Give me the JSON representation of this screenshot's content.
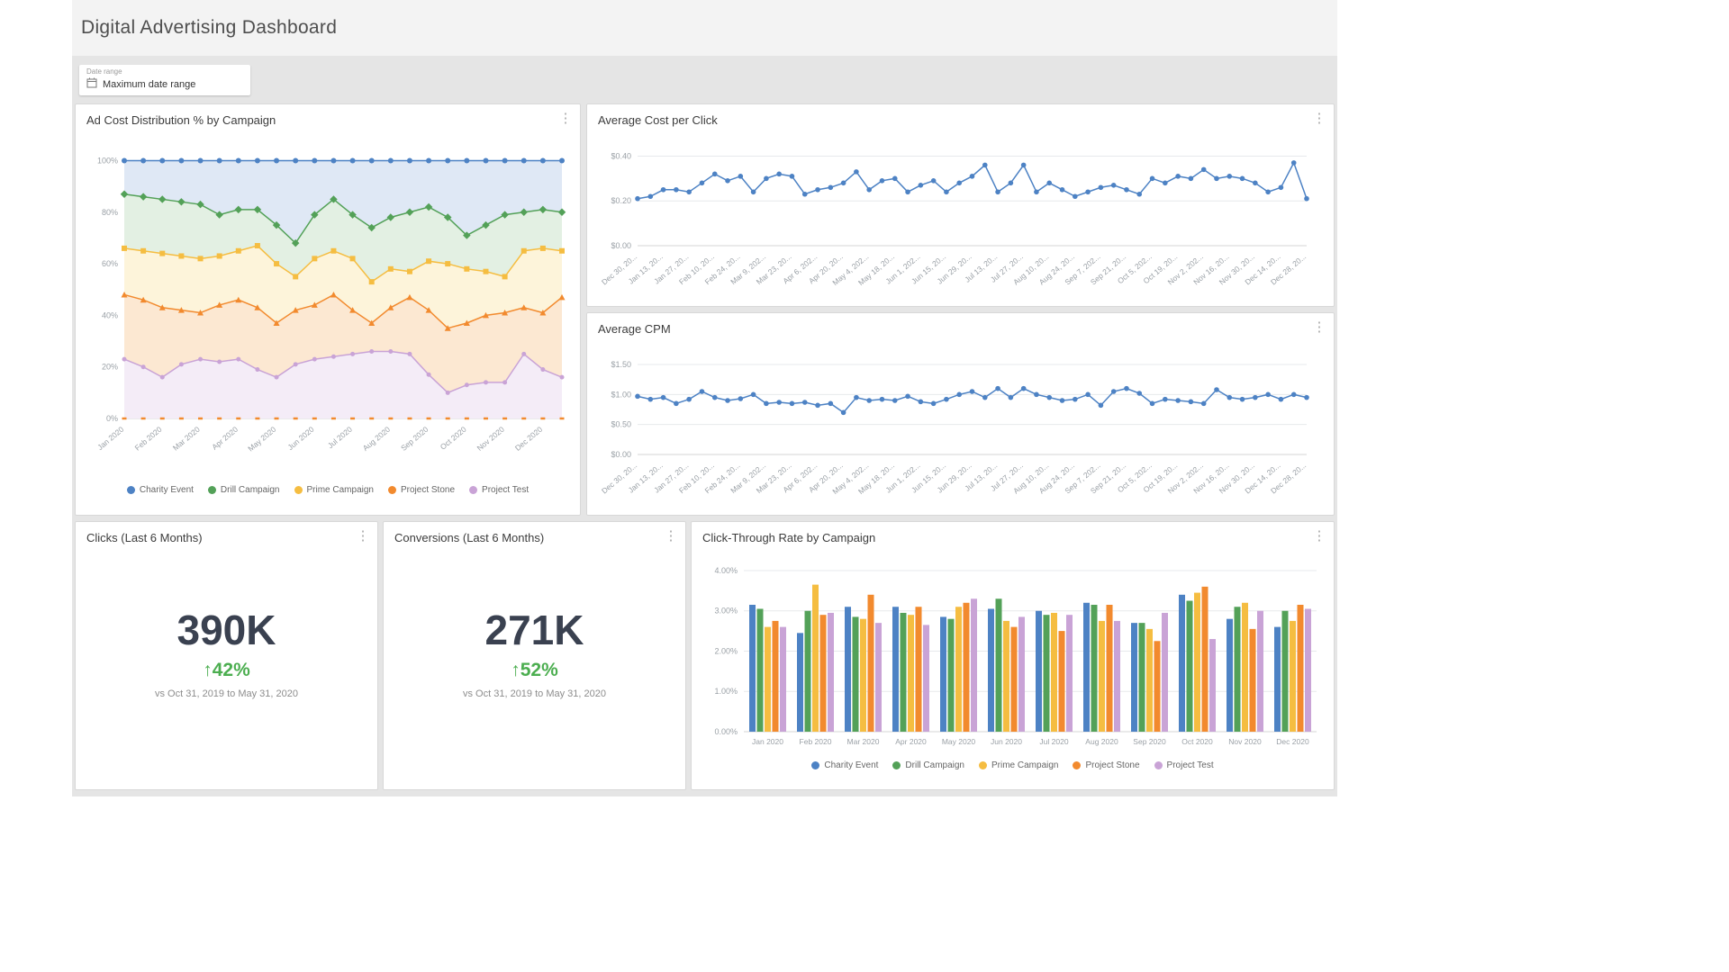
{
  "page": {
    "title": "Digital Advertising Dashboard"
  },
  "filter": {
    "label": "Date range",
    "value": "Maximum date range"
  },
  "cards": {
    "clicks": {
      "title": "Clicks (Last 6 Months)",
      "value": "390K",
      "delta": "↑42%",
      "compare": "vs Oct 31, 2019 to May 31, 2020"
    },
    "conversions": {
      "title": "Conversions (Last 6 Months)",
      "value": "271K",
      "delta": "↑52%",
      "compare": "vs Oct 31, 2019 to May 31, 2020"
    }
  },
  "chart_data": [
    {
      "type": "area",
      "title": "Ad Cost Distribution % by Campaign",
      "stacked_fill": true,
      "rotate_labels": true,
      "tick_labels": [
        "Jan 2020",
        "Feb 2020",
        "Mar 2020",
        "Apr 2020",
        "May 2020",
        "Jun 2020",
        "Jul 2020",
        "Aug 2020",
        "Sep 2020",
        "Oct 2020",
        "Nov 2020",
        "Dec 2020"
      ],
      "tick_every": 2,
      "ylim": [
        0,
        104
      ],
      "y_ticks": [
        0,
        20,
        40,
        60,
        80,
        100
      ],
      "y_tick_labels": [
        "0%",
        "20%",
        "40%",
        "60%",
        "80%",
        "100%"
      ],
      "series": [
        {
          "name": "Charity Event",
          "color": "#4d82c4",
          "fill": "#dfe8f5",
          "marker": "circle",
          "marker_r": 3,
          "values": [
            100,
            100,
            100,
            100,
            100,
            100,
            100,
            100,
            100,
            100,
            100,
            100,
            100,
            100,
            100,
            100,
            100,
            100,
            100,
            100,
            100,
            100,
            100,
            100
          ]
        },
        {
          "name": "Drill Campaign",
          "color": "#53a158",
          "fill": "#e3f0e3",
          "marker": "diamond",
          "marker_r": 3,
          "values": [
            87,
            86,
            85,
            84,
            83,
            79,
            81,
            81,
            75,
            68,
            79,
            85,
            79,
            74,
            78,
            80,
            82,
            78,
            71,
            75,
            79,
            80,
            81,
            80
          ]
        },
        {
          "name": "Prime Campaign",
          "color": "#f5bd41",
          "fill": "#fdf4da",
          "marker": "square",
          "marker_r": 3,
          "values": [
            66,
            65,
            64,
            63,
            62,
            63,
            65,
            67,
            60,
            55,
            62,
            65,
            62,
            53,
            58,
            57,
            61,
            60,
            58,
            57,
            55,
            65,
            66,
            65
          ]
        },
        {
          "name": "Project Stone",
          "color": "#f28a2e",
          "fill": "#fce8d2",
          "marker": "triangle",
          "marker_r": 3,
          "values": [
            48,
            46,
            43,
            42,
            41,
            44,
            46,
            43,
            37,
            42,
            44,
            48,
            42,
            37,
            43,
            47,
            42,
            35,
            37,
            40,
            41,
            43,
            41,
            47
          ]
        },
        {
          "name": "Project Test",
          "color": "#c9a3d6",
          "fill": "#f4ecf7",
          "marker": "circle",
          "marker_r": 2.5,
          "values": [
            23,
            20,
            16,
            21,
            23,
            22,
            23,
            19,
            16,
            21,
            23,
            24,
            25,
            26,
            26,
            25,
            17,
            10,
            13,
            14,
            14,
            25,
            19,
            16
          ]
        },
        {
          "name": "",
          "color": "#f28a2e",
          "marker": "dash",
          "line": false,
          "values": [
            0,
            0,
            0,
            0,
            0,
            0,
            0,
            0,
            0,
            0,
            0,
            0,
            0,
            0,
            0,
            0,
            0,
            0,
            0,
            0,
            0,
            0,
            0,
            0
          ]
        }
      ],
      "legend": [
        {
          "label": "Charity Event",
          "color": "#4d82c4"
        },
        {
          "label": "Drill Campaign",
          "color": "#53a158"
        },
        {
          "label": "Prime Campaign",
          "color": "#f5bd41"
        },
        {
          "label": "Project Stone",
          "color": "#f28a2e"
        },
        {
          "label": "Project Test",
          "color": "#c9a3d6"
        }
      ]
    },
    {
      "type": "line",
      "title": "Average Cost per Click",
      "rotate_labels": true,
      "tick_labels": [
        "Dec 30, 20...",
        "Jan 13, 20...",
        "Jan 27, 20...",
        "Feb 10, 20...",
        "Feb 24, 20...",
        "Mar 9, 202...",
        "Mar 23, 20...",
        "Apr 6, 202...",
        "Apr 20, 20...",
        "May 4, 202...",
        "May 18, 20...",
        "Jun 1, 202...",
        "Jun 15, 20...",
        "Jun 29, 20...",
        "Jul 13, 20...",
        "Jul 27, 20...",
        "Aug 10, 20...",
        "Aug 24, 20...",
        "Sep 7, 202...",
        "Sep 21, 20...",
        "Oct 5, 202...",
        "Oct 19, 20...",
        "Nov 2, 202...",
        "Nov 16, 20...",
        "Nov 30, 20...",
        "Dec 14, 20...",
        "Dec 28, 20..."
      ],
      "tick_every": 2,
      "ylim": [
        0,
        0.45
      ],
      "y_ticks": [
        0,
        0.2,
        0.4
      ],
      "y_tick_labels": [
        "$0.00",
        "$0.20",
        "$0.40"
      ],
      "series": [
        {
          "name": "Average Cost per Click",
          "color": "#4d82c4",
          "marker": "circle",
          "marker_r": 2.8,
          "values": [
            0.21,
            0.22,
            0.25,
            0.25,
            0.24,
            0.28,
            0.32,
            0.29,
            0.31,
            0.24,
            0.3,
            0.32,
            0.31,
            0.23,
            0.25,
            0.26,
            0.28,
            0.33,
            0.25,
            0.29,
            0.3,
            0.24,
            0.27,
            0.29,
            0.24,
            0.28,
            0.31,
            0.36,
            0.24,
            0.28,
            0.36,
            0.24,
            0.28,
            0.25,
            0.22,
            0.24,
            0.26,
            0.27,
            0.25,
            0.23,
            0.3,
            0.28,
            0.31,
            0.3,
            0.34,
            0.3,
            0.31,
            0.3,
            0.28,
            0.24,
            0.26,
            0.37,
            0.21
          ]
        }
      ]
    },
    {
      "type": "line",
      "title": "Average CPM",
      "rotate_labels": true,
      "tick_labels": [
        "Dec 30, 20...",
        "Jan 13, 20...",
        "Jan 27, 20...",
        "Feb 10, 20...",
        "Feb 24, 20...",
        "Mar 9, 202...",
        "Mar 23, 20...",
        "Apr 6, 202...",
        "Apr 20, 20...",
        "May 4, 202...",
        "May 18, 20...",
        "Jun 1, 202...",
        "Jun 15, 20...",
        "Jun 29, 20...",
        "Jul 13, 20...",
        "Jul 27, 20...",
        "Aug 10, 20...",
        "Aug 24, 20...",
        "Sep 7, 202...",
        "Sep 21, 20...",
        "Oct 5, 202...",
        "Oct 19, 20...",
        "Nov 2, 202...",
        "Nov 16, 20...",
        "Nov 30, 20...",
        "Dec 14, 20...",
        "Dec 28, 20..."
      ],
      "tick_every": 2,
      "ylim": [
        0,
        1.68
      ],
      "y_ticks": [
        0,
        0.5,
        1.0,
        1.5
      ],
      "y_tick_labels": [
        "$0.00",
        "$0.50",
        "$1.00",
        "$1.50"
      ],
      "series": [
        {
          "name": "Average CPM",
          "color": "#4d82c4",
          "marker": "circle",
          "marker_r": 2.8,
          "values": [
            0.97,
            0.92,
            0.95,
            0.85,
            0.92,
            1.05,
            0.95,
            0.9,
            0.93,
            1.0,
            0.85,
            0.87,
            0.85,
            0.87,
            0.82,
            0.85,
            0.7,
            0.95,
            0.9,
            0.92,
            0.9,
            0.97,
            0.88,
            0.85,
            0.92,
            1.0,
            1.05,
            0.95,
            1.1,
            0.95,
            1.1,
            1.0,
            0.95,
            0.9,
            0.92,
            1.0,
            0.82,
            1.05,
            1.1,
            1.02,
            0.85,
            0.92,
            0.9,
            0.88,
            0.85,
            1.08,
            0.95,
            0.92,
            0.95,
            1.0,
            0.92,
            1.0,
            0.95
          ]
        }
      ]
    },
    {
      "type": "bar",
      "title": "Click-Through Rate by Campaign",
      "categories": [
        "Jan 2020",
        "Feb 2020",
        "Mar 2020",
        "Apr 2020",
        "May 2020",
        "Jun 2020",
        "Jul 2020",
        "Aug 2020",
        "Sep 2020",
        "Oct 2020",
        "Nov 2020",
        "Dec 2020"
      ],
      "ylim": [
        0,
        4.2
      ],
      "y_ticks": [
        0,
        1,
        2,
        3,
        4
      ],
      "y_tick_labels": [
        "0.00%",
        "1.00%",
        "2.00%",
        "3.00%",
        "4.00%"
      ],
      "series": [
        {
          "name": "Charity Event",
          "color": "#4d82c4",
          "values": [
            3.15,
            2.45,
            3.1,
            3.1,
            2.85,
            3.05,
            3.0,
            3.2,
            2.7,
            3.4,
            2.8,
            2.6
          ]
        },
        {
          "name": "Drill Campaign",
          "color": "#53a158",
          "values": [
            3.05,
            3.0,
            2.85,
            2.95,
            2.8,
            3.3,
            2.9,
            3.15,
            2.7,
            3.25,
            3.1,
            3.0
          ]
        },
        {
          "name": "Prime Campaign",
          "color": "#f5bd41",
          "values": [
            2.6,
            3.65,
            2.8,
            2.9,
            3.1,
            2.75,
            2.95,
            2.75,
            2.55,
            3.45,
            3.2,
            2.75
          ]
        },
        {
          "name": "Project Stone",
          "color": "#f28a2e",
          "values": [
            2.75,
            2.9,
            3.4,
            3.1,
            3.2,
            2.6,
            2.5,
            3.15,
            2.25,
            3.6,
            2.55,
            3.15
          ]
        },
        {
          "name": "Project Test",
          "color": "#c9a3d6",
          "values": [
            2.6,
            2.95,
            2.7,
            2.65,
            3.3,
            2.85,
            2.9,
            2.75,
            2.95,
            2.3,
            3.0,
            3.05
          ]
        }
      ],
      "legend": [
        {
          "label": "Charity Event",
          "color": "#4d82c4"
        },
        {
          "label": "Drill Campaign",
          "color": "#53a158"
        },
        {
          "label": "Prime Campaign",
          "color": "#f5bd41"
        },
        {
          "label": "Project Stone",
          "color": "#f28a2e"
        },
        {
          "label": "Project Test",
          "color": "#c9a3d6"
        }
      ]
    }
  ]
}
